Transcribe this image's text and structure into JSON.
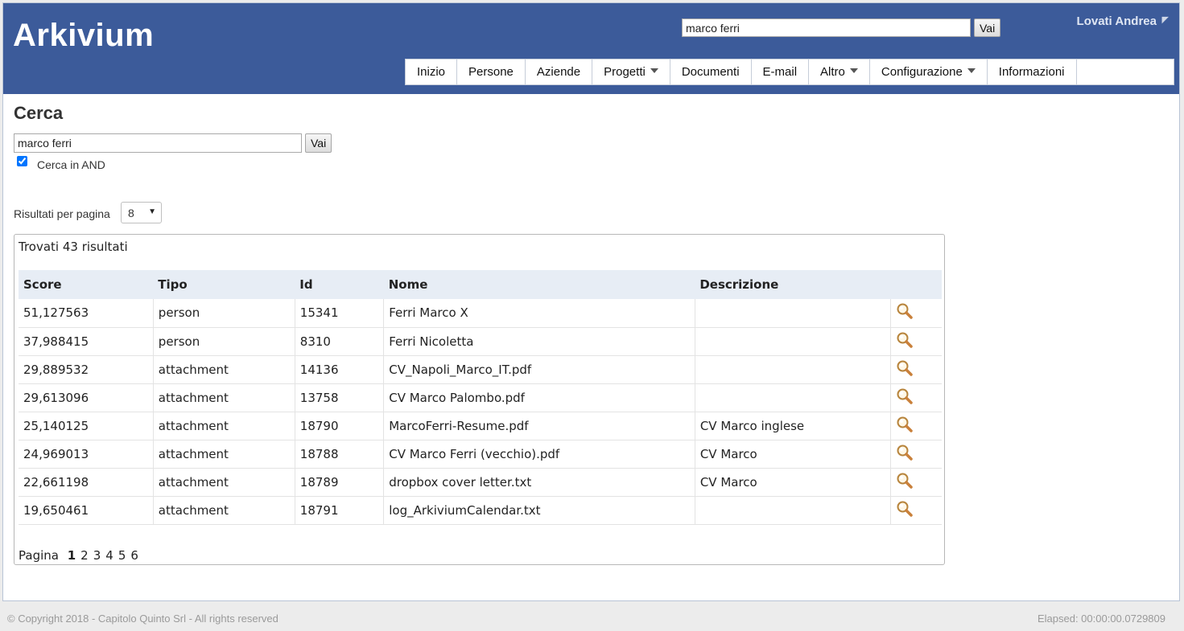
{
  "app": {
    "brand": "Arkivium",
    "user": "Lovati Andrea"
  },
  "top_search": {
    "value": "marco ferri",
    "button": "Vai"
  },
  "nav": {
    "items": [
      {
        "label": "Inizio",
        "dropdown": false
      },
      {
        "label": "Persone",
        "dropdown": false
      },
      {
        "label": "Aziende",
        "dropdown": false
      },
      {
        "label": "Progetti",
        "dropdown": true
      },
      {
        "label": "Documenti",
        "dropdown": false
      },
      {
        "label": "E-mail",
        "dropdown": false
      },
      {
        "label": "Altro",
        "dropdown": true
      },
      {
        "label": "Configurazione",
        "dropdown": true
      },
      {
        "label": "Informazioni",
        "dropdown": false
      }
    ]
  },
  "page": {
    "title": "Cerca",
    "search_value": "marco ferri",
    "search_button": "Vai",
    "and_label": "Cerca in AND",
    "and_checked": true,
    "per_page_label": "Risultati per pagina",
    "per_page_value": "8"
  },
  "results": {
    "found": "Trovati 43 risultati",
    "columns": [
      "Score",
      "Tipo",
      "Id",
      "Nome",
      "Descrizione"
    ],
    "rows": [
      {
        "score": "51,127563",
        "tipo": "person",
        "id": "15341",
        "nome": "Ferri Marco X",
        "descr": ""
      },
      {
        "score": "37,988415",
        "tipo": "person",
        "id": "8310",
        "nome": "Ferri Nicoletta",
        "descr": ""
      },
      {
        "score": "29,889532",
        "tipo": "attachment",
        "id": "14136",
        "nome": "CV_Napoli_Marco_IT.pdf",
        "descr": ""
      },
      {
        "score": "29,613096",
        "tipo": "attachment",
        "id": "13758",
        "nome": "CV Marco Palombo.pdf",
        "descr": ""
      },
      {
        "score": "25,140125",
        "tipo": "attachment",
        "id": "18790",
        "nome": "MarcoFerri-Resume.pdf",
        "descr": "CV Marco inglese"
      },
      {
        "score": "24,969013",
        "tipo": "attachment",
        "id": "18788",
        "nome": "CV Marco Ferri (vecchio).pdf",
        "descr": "CV Marco"
      },
      {
        "score": "22,661198",
        "tipo": "attachment",
        "id": "18789",
        "nome": "dropbox cover letter.txt",
        "descr": "CV Marco"
      },
      {
        "score": "19,650461",
        "tipo": "attachment",
        "id": "18791",
        "nome": "log_ArkiviumCalendar.txt",
        "descr": ""
      }
    ],
    "pager_label": "Pagina",
    "pages": [
      "1",
      "2",
      "3",
      "4",
      "5",
      "6"
    ],
    "current_page": "1"
  },
  "footer": {
    "copyright": "© Copyright 2018 - Capitolo Quinto Srl - All rights reserved",
    "elapsed": "Elapsed: 00:00:00.0729809"
  },
  "colors": {
    "header": "#3c5b9a",
    "table_header": "#e7edf5"
  }
}
